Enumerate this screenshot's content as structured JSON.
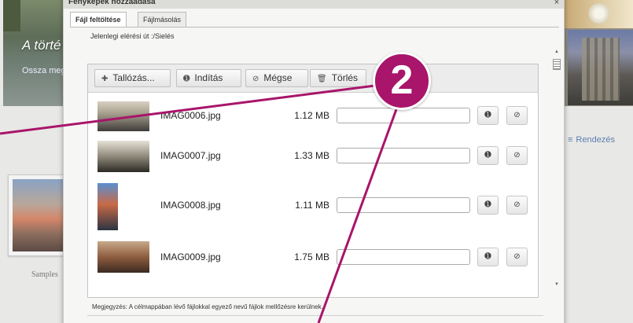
{
  "background": {
    "banner_title": "A törté",
    "banner_subtitle": "Ossza meg",
    "sort_label": "Rendezés",
    "album_label": "Samples"
  },
  "dialog": {
    "title": "Fényképek hozzáadása",
    "close_glyph": "×",
    "tabs": [
      {
        "label": "Fájl feltöltése",
        "active": true
      },
      {
        "label": "Fájlmásolás",
        "active": false
      }
    ],
    "path_label": "Jelenlegi elérési út :/Sielés",
    "toolbar": {
      "browse": "Tallózás...",
      "start": "Indítás",
      "cancel": "Mégse",
      "delete": "Törlés"
    },
    "files": [
      {
        "name": "IMAG0006.jpg",
        "size": "1.12 MB",
        "progress": 0
      },
      {
        "name": "IMAG0007.jpg",
        "size": "1.33 MB",
        "progress": 0
      },
      {
        "name": "IMAG0008.jpg",
        "size": "1.11 MB",
        "progress": 0
      },
      {
        "name": "IMAG0009.jpg",
        "size": "1.75 MB",
        "progress": 0
      }
    ],
    "note": "Megjegyzés: A célmappában lévő fájlokkal egyező nevű fájlok mellőzésre kerülnek."
  },
  "callout": {
    "number": "2",
    "color": "#a8156a"
  },
  "icons": {
    "browse": "plus-icon",
    "start": "play-circle-icon",
    "cancel": "cancel-icon",
    "delete": "trash-icon",
    "sort": "list-icon"
  }
}
